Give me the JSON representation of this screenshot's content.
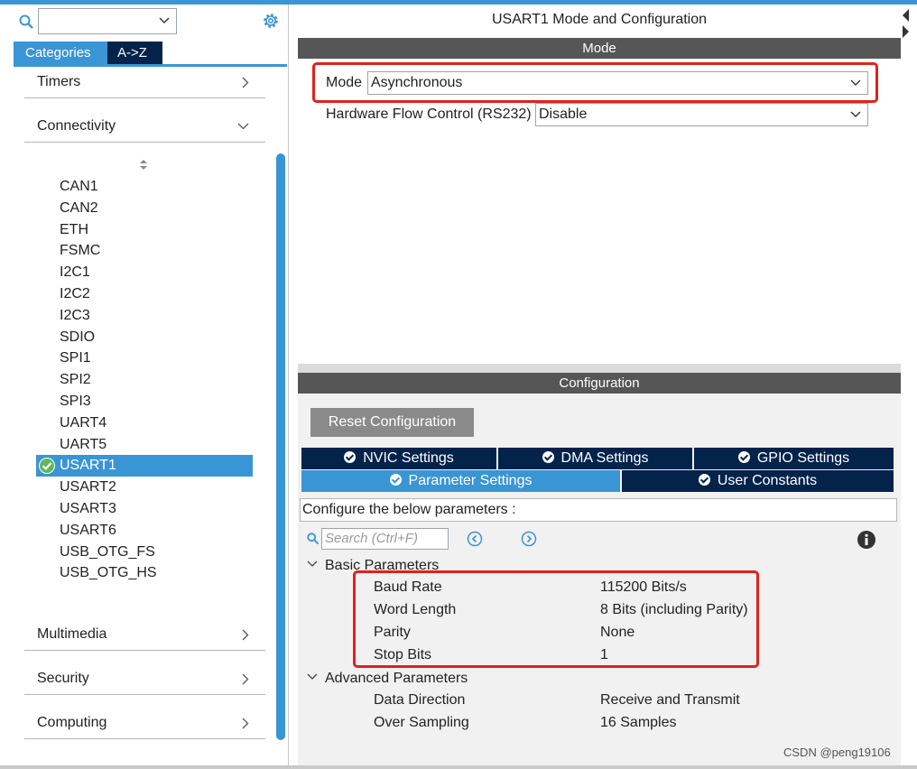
{
  "left": {
    "search": {
      "value": ""
    },
    "tabs": [
      {
        "label": "Categories"
      },
      {
        "label": "A->Z"
      }
    ],
    "categories": {
      "timers": "Timers",
      "connectivity": "Connectivity",
      "multimedia": "Multimedia",
      "security": "Security",
      "computing": "Computing"
    },
    "peripherals": [
      "CAN1",
      "CAN2",
      "ETH",
      "FSMC",
      "I2C1",
      "I2C2",
      "I2C3",
      "SDIO",
      "SPI1",
      "SPI2",
      "SPI3",
      "UART4",
      "UART5",
      "USART1",
      "USART2",
      "USART3",
      "USART6",
      "USB_OTG_FS",
      "USB_OTG_HS"
    ],
    "selected": "USART1"
  },
  "right": {
    "title": "USART1 Mode and Configuration",
    "mode_band": "Mode",
    "mode_label": "Mode",
    "mode_value": "Asynchronous",
    "hwflow_label": "Hardware Flow Control (RS232)",
    "hwflow_value": "Disable",
    "config_band": "Configuration",
    "reset_button": "Reset Configuration",
    "tabs_row1": [
      "NVIC Settings",
      "DMA Settings",
      "GPIO Settings"
    ],
    "tabs_row2": [
      "Parameter Settings",
      "User Constants"
    ],
    "configure_text": "Configure the below parameters :",
    "search_placeholder": "Search (Ctrl+F)",
    "basic_header": "Basic Parameters",
    "basic": [
      {
        "k": "Baud Rate",
        "v": "115200 Bits/s"
      },
      {
        "k": "Word Length",
        "v": "8 Bits (including Parity)"
      },
      {
        "k": "Parity",
        "v": "None"
      },
      {
        "k": "Stop Bits",
        "v": "1"
      }
    ],
    "advanced_header": "Advanced Parameters",
    "advanced": [
      {
        "k": "Data Direction",
        "v": "Receive and Transmit"
      },
      {
        "k": "Over Sampling",
        "v": "16 Samples"
      }
    ]
  },
  "watermark": "CSDN @peng19106",
  "colors": {
    "accent": "#3a95d4",
    "navy": "#03234b",
    "highlight": "#e0211d"
  }
}
